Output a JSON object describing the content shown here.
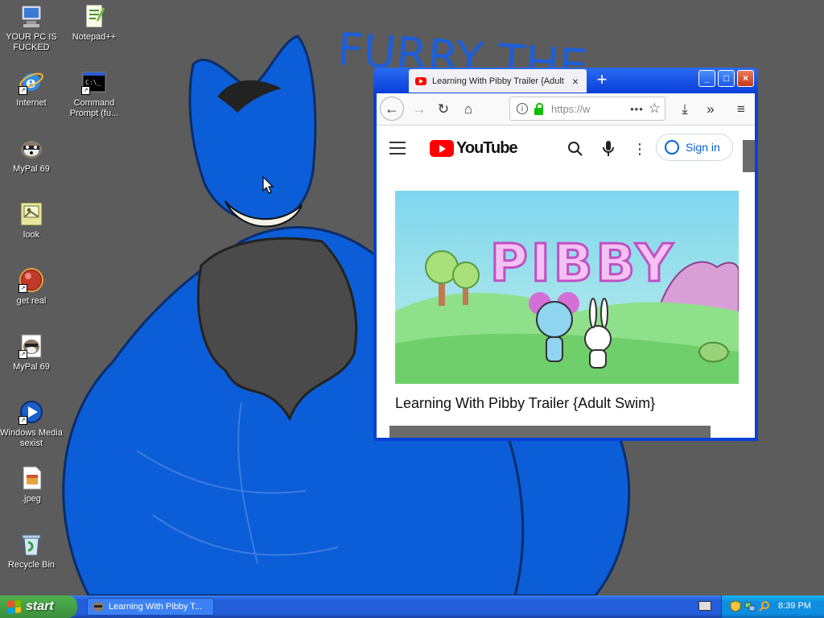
{
  "desktop": {
    "wallpaper_text": "FURRY THE",
    "icons": [
      {
        "label": "YOUR PC IS FUCKED",
        "icon": "computer-icon"
      },
      {
        "label": "Notepad++",
        "icon": "notepad-icon"
      },
      {
        "label": "Internet",
        "icon": "internet-explorer-icon"
      },
      {
        "label": "Command Prompt (fu...",
        "icon": "command-prompt-icon"
      },
      {
        "label": "MyPal 69",
        "icon": "raccoon-icon"
      },
      {
        "label": "look",
        "icon": "image-file-icon"
      },
      {
        "label": "get real",
        "icon": "red-orb-icon"
      },
      {
        "label": "MyPal 69",
        "icon": "raccoon-icon"
      },
      {
        "label": "Windows Media sexist",
        "icon": "media-player-icon"
      },
      {
        "label": ".jpeg",
        "icon": "jpeg-file-icon"
      },
      {
        "label": "Recycle Bin",
        "icon": "recycle-bin-icon"
      }
    ]
  },
  "browser": {
    "tab_title": "Learning With Pibby Trailer {Adult",
    "tab_close": "×",
    "new_tab": "+",
    "url": "https://w",
    "url_more": "•••",
    "controls": {
      "minimize": "_",
      "maximize": "□",
      "close": "×"
    }
  },
  "youtube": {
    "logo_text": "YouTube",
    "sign_in_label": "Sign in",
    "thumbnail_text": "PIBBY",
    "video_title": "Learning With Pibby Trailer {Adult Swim}"
  },
  "taskbar": {
    "start_label": "start",
    "task_label": "Learning With Pibby T...",
    "clock": "8:39 PM"
  },
  "colors": {
    "xp_blue": "#0a3fd8",
    "youtube_red": "#ff0000",
    "link_blue": "#065fd4",
    "start_green": "#3c8f3c"
  }
}
